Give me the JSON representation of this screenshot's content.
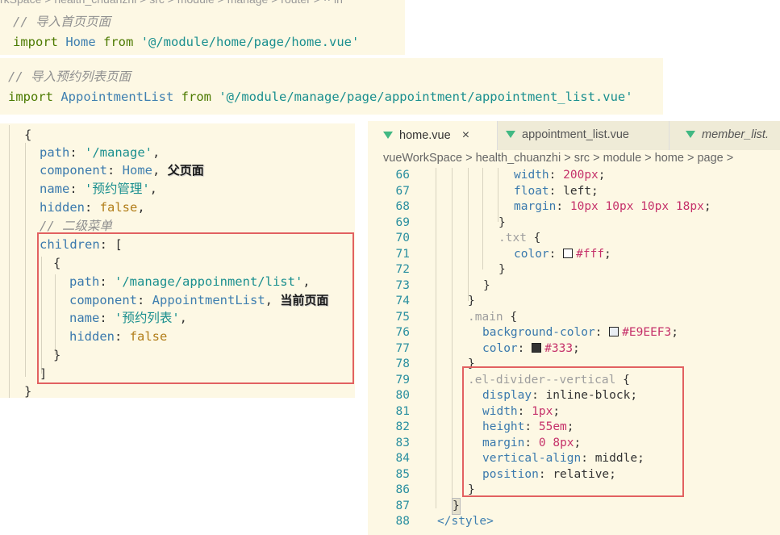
{
  "snippet1": {
    "path_fragment": "rkSpace > health_chuanzhi > src > module > manage > router > ·· in",
    "comment": "// 导入首页页面",
    "import_kw": "import",
    "ident": "Home",
    "from_kw": "from",
    "path": "'@/module/home/page/home.vue'"
  },
  "snippet2": {
    "comment": "// 导入预约列表页面",
    "import_kw": "import",
    "ident": "AppointmentList",
    "from_kw": "from",
    "path": "'@/module/manage/page/appointment/appointment_list.vue'"
  },
  "snippet3": {
    "open_brace": "{",
    "path_key": "path",
    "path_val": "'/manage'",
    "component_key": "component",
    "component_val": "Home",
    "note_parent": "父页面",
    "name_key": "name",
    "name_val": "'预约管理'",
    "hidden_key": "hidden",
    "hidden_val": "false",
    "comment": "// 二级菜单",
    "children_key": "children",
    "open_bracket": "[",
    "inner_open": "{",
    "c_path_key": "path",
    "c_path_val": "'/manage/appoinment/list'",
    "c_component_key": "component",
    "c_component_val": "AppointmentList",
    "note_current": "当前页面",
    "c_name_key": "name",
    "c_name_val": "'预约列表'",
    "c_hidden_key": "hidden",
    "c_hidden_val": "false",
    "inner_close": "}",
    "close_bracket": "]",
    "close_brace": "}"
  },
  "editor": {
    "tabs": [
      {
        "label": "home.vue",
        "active": true,
        "close": "×"
      },
      {
        "label": "appointment_list.vue",
        "active": false
      },
      {
        "label": "member_list.",
        "active": false
      }
    ],
    "breadcrumb": "vueWorkSpace > health_chuanzhi > src > module > home > page >",
    "line_numbers": [
      "66",
      "67",
      "68",
      "69",
      "70",
      "71",
      "72",
      "73",
      "74",
      "75",
      "76",
      "77",
      "78",
      "79",
      "80",
      "81",
      "82",
      "83",
      "84",
      "85",
      "86",
      "87",
      "88"
    ],
    "code": {
      "l66": {
        "prop": "width",
        "val": "200",
        "unit": "px"
      },
      "l67": {
        "prop": "float",
        "val": "left"
      },
      "l68": {
        "prop": "margin",
        "v1": "10",
        "v2": "10",
        "v3": "10",
        "v4": "18",
        "unit": "px"
      },
      "l69": "}",
      "l70": {
        "sel": ".txt",
        "brace": "{"
      },
      "l71": {
        "prop": "color",
        "val": "#fff"
      },
      "l72": "}",
      "l73": "}",
      "l74": "}",
      "l75": {
        "sel": ".main",
        "brace": "{"
      },
      "l76": {
        "prop": "background-color",
        "val": "#E9EEF3"
      },
      "l77": {
        "prop": "color",
        "val": "#333"
      },
      "l78": "}",
      "l79": {
        "sel": ".el-divider--vertical",
        "brace": "{"
      },
      "l80": {
        "prop": "display",
        "val": "inline-block"
      },
      "l81": {
        "prop": "width",
        "val": "1",
        "unit": "px"
      },
      "l82": {
        "prop": "height",
        "val": "55",
        "unit": "em"
      },
      "l83": {
        "prop": "margin",
        "v1": "0",
        "v2": "8",
        "unit": "px"
      },
      "l84": {
        "prop": "vertical-align",
        "val": "middle"
      },
      "l85": {
        "prop": "position",
        "val": "relative"
      },
      "l86": "}",
      "l87": "}",
      "l88": "</style>"
    }
  },
  "colors": {
    "editor_bg": "#fdf8e4",
    "highlight_box": "#e26161",
    "vue_icon": "#41b883",
    "swatch_white": "#fff",
    "swatch_dark": "#333",
    "swatch_light": "#E9EEF3"
  }
}
